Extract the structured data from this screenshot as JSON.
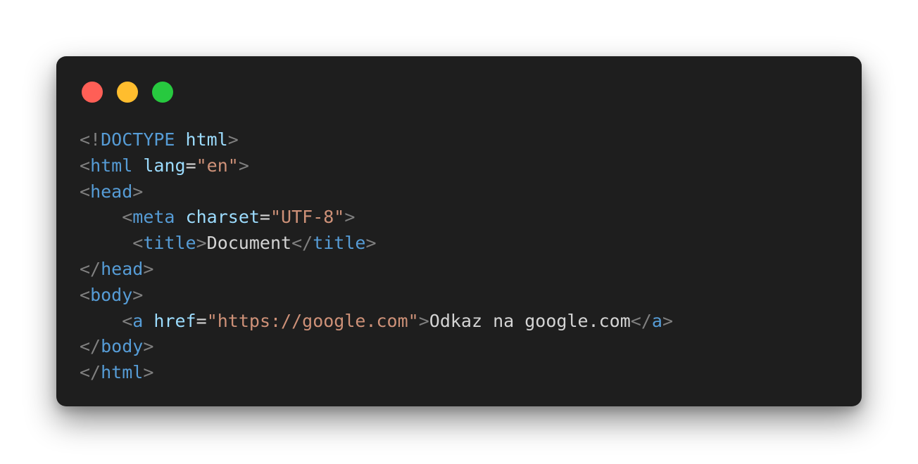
{
  "colors": {
    "background": "#ffffff",
    "window": "#1e1e1e",
    "dot_red": "#ff5f56",
    "dot_yellow": "#ffbd2e",
    "dot_green": "#27c93f",
    "tag": "#569cd6",
    "attribute": "#9cdcfe",
    "string": "#ce9178",
    "punctuation": "#808080",
    "text": "#d4d4d4"
  },
  "code": {
    "line1": {
      "open": "<!",
      "keyword": "DOCTYPE",
      "space": " ",
      "doctype": "html",
      "close": ">"
    },
    "line2": {
      "open": "<",
      "tag": "html",
      "space": " ",
      "attr": "lang",
      "eq": "=",
      "value": "\"en\"",
      "close": ">"
    },
    "line3": {
      "open": "<",
      "tag": "head",
      "close": ">"
    },
    "line4": {
      "indent": "    ",
      "open": "<",
      "tag": "meta",
      "space": " ",
      "attr": "charset",
      "eq": "=",
      "value": "\"UTF-8\"",
      "close": ">"
    },
    "line5": {
      "indent": "     ",
      "open": "<",
      "tag": "title",
      "close": ">",
      "text": "Document",
      "end_open": "</",
      "end_tag": "title",
      "end_close": ">"
    },
    "line6": {
      "open": "</",
      "tag": "head",
      "close": ">"
    },
    "line7": {
      "open": "<",
      "tag": "body",
      "close": ">"
    },
    "line8": {
      "indent": "    ",
      "open": "<",
      "tag": "a",
      "space": " ",
      "attr": "href",
      "eq": "=",
      "value": "\"https://google.com\"",
      "close": ">",
      "text": "Odkaz na google.com",
      "end_open": "</",
      "end_tag": "a",
      "end_close": ">"
    },
    "line9": {
      "open": "</",
      "tag": "body",
      "close": ">"
    },
    "line10": {
      "open": "</",
      "tag": "html",
      "close": ">"
    }
  }
}
